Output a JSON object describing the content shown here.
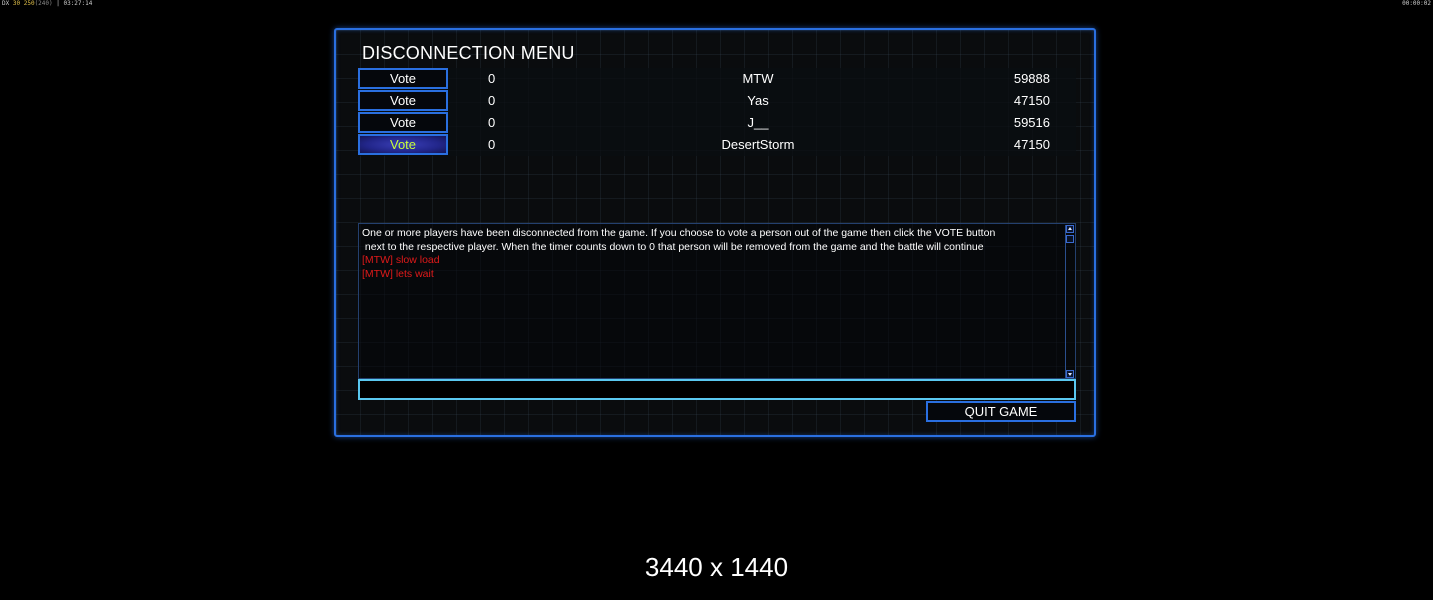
{
  "hud": {
    "top_left_a": "DX",
    "top_left_fps": "30",
    "top_left_b": "250",
    "top_left_ms": "(240)",
    "top_left_time": "03:27:14",
    "top_right": "00:00:02"
  },
  "menu": {
    "title": "DISCONNECTION MENU",
    "players": [
      {
        "vote_label": "Vote",
        "votes": "0",
        "name": "MTW",
        "score": "59888",
        "selected": false
      },
      {
        "vote_label": "Vote",
        "votes": "0",
        "name": "Yas",
        "score": "47150",
        "selected": false
      },
      {
        "vote_label": "Vote",
        "votes": "0",
        "name": "J__",
        "score": "59516",
        "selected": false
      },
      {
        "vote_label": "Vote",
        "votes": "0",
        "name": "DesertStorm",
        "score": "47150",
        "selected": true
      }
    ],
    "chat": {
      "system_line_1": "One or more players have been disconnected from the game. If you choose to vote a person out of the game then click the VOTE button",
      "system_line_2": " next to the respective player. When the timer counts down to 0 that person will be removed from the game and the battle will continue",
      "messages": [
        "[MTW] slow load",
        "[MTW] lets wait"
      ]
    },
    "input_value": "",
    "quit_label": "QUIT GAME"
  },
  "resolution_label": "3440 x 1440",
  "colors": {
    "accent_border": "#2a6fe0",
    "input_border": "#5ac8f0",
    "chat_message": "#e01a1a",
    "selected_vote_text": "#c8ff3a"
  }
}
